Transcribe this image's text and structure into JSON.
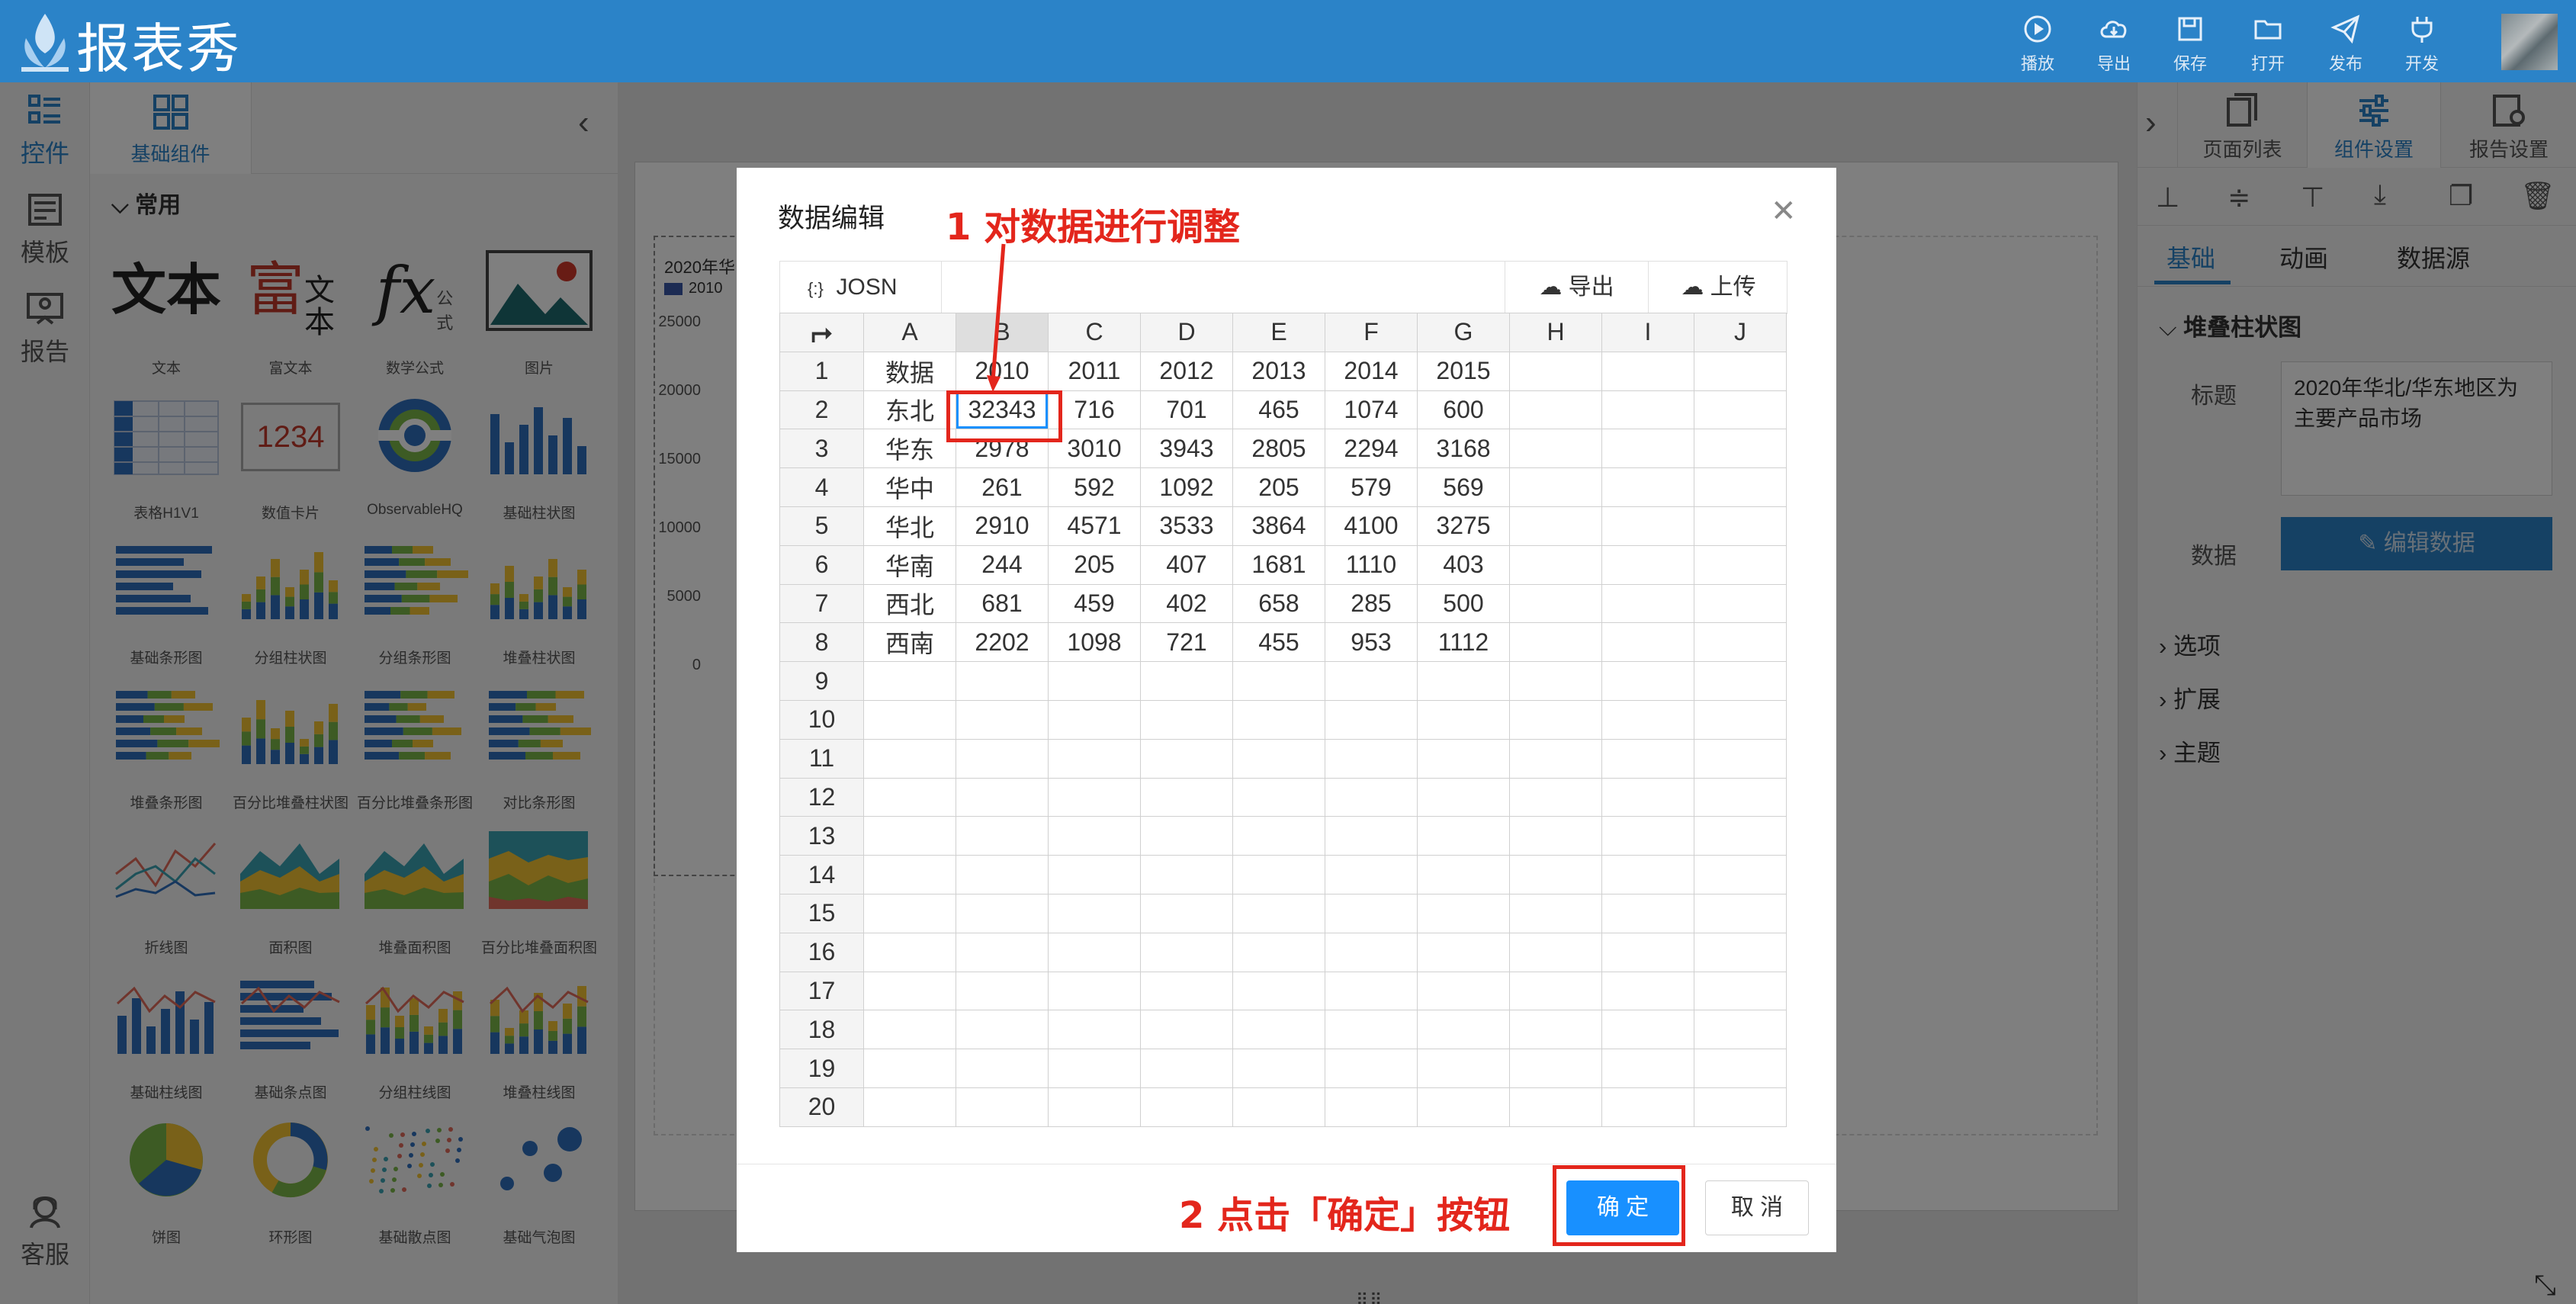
{
  "app": {
    "brand": "报表秀"
  },
  "header_actions": [
    {
      "label": "播放",
      "icon": "play-icon"
    },
    {
      "label": "导出",
      "icon": "download-cloud-icon"
    },
    {
      "label": "保存",
      "icon": "save-icon"
    },
    {
      "label": "打开",
      "icon": "folder-icon"
    },
    {
      "label": "发布",
      "icon": "send-icon"
    },
    {
      "label": "开发",
      "icon": "plug-icon"
    }
  ],
  "rail": [
    {
      "label": "控件",
      "icon": "widgets-icon",
      "active": true
    },
    {
      "label": "模板",
      "icon": "template-icon"
    },
    {
      "label": "报告",
      "icon": "report-icon"
    },
    {
      "label": "客服",
      "icon": "support-icon"
    }
  ],
  "component_panel": {
    "tab_label": "基础组件",
    "group_title": "常用",
    "items": [
      "文本",
      "富文本",
      "数学公式",
      "图片",
      "表格H1V1",
      "数值卡片",
      "ObservableHQ",
      "基础柱状图",
      "基础条形图",
      "分组柱状图",
      "分组条形图",
      "堆叠柱状图",
      "堆叠条形图",
      "百分比堆叠柱状图",
      "百分比堆叠条形图",
      "对比条形图",
      "折线图",
      "面积图",
      "堆叠面积图",
      "百分比堆叠面积图",
      "基础柱线图",
      "基础条点图",
      "分组柱线图",
      "堆叠柱线图",
      "饼图",
      "环形图",
      "基础散点图",
      "基础气泡图"
    ],
    "thumb_text": {
      "text": "文本",
      "rich_main": "富",
      "rich_sub": "文本",
      "formula": "fx",
      "formula_sub": "公式",
      "number": "1234"
    }
  },
  "canvas_chart": {
    "title_fragment": "2020年华",
    "legend": "2010",
    "yticks": [
      "25000",
      "20000",
      "15000",
      "10000",
      "5000",
      "0"
    ]
  },
  "right_panel": {
    "top_tabs": [
      "页面列表",
      "组件设置",
      "报告设置"
    ],
    "sub_tabs": [
      "基础",
      "动画",
      "数据源"
    ],
    "section_title": "堆叠柱状图",
    "title_label": "标题",
    "title_value": "2020年华北/华东地区为主要产品市场",
    "data_label": "数据",
    "edit_data_button": "编辑数据",
    "collapsed_sections": [
      "选项",
      "扩展",
      "主题"
    ]
  },
  "modal": {
    "title": "数据编辑",
    "json_button": "JOSN",
    "export_button": "导出",
    "upload_button": "上传",
    "ok_button": "确 定",
    "cancel_button": "取 消",
    "columns": [
      "A",
      "B",
      "C",
      "D",
      "E",
      "F",
      "G",
      "H",
      "I",
      "J"
    ],
    "rows": [
      [
        "数据",
        "2010",
        "2011",
        "2012",
        "2013",
        "2014",
        "2015",
        "",
        "",
        ""
      ],
      [
        "东北",
        "32343",
        "716",
        "701",
        "465",
        "1074",
        "600",
        "",
        "",
        ""
      ],
      [
        "华东",
        "2978",
        "3010",
        "3943",
        "2805",
        "2294",
        "3168",
        "",
        "",
        ""
      ],
      [
        "华中",
        "261",
        "592",
        "1092",
        "205",
        "579",
        "569",
        "",
        "",
        ""
      ],
      [
        "华北",
        "2910",
        "4571",
        "3533",
        "3864",
        "4100",
        "3275",
        "",
        "",
        ""
      ],
      [
        "华南",
        "244",
        "205",
        "407",
        "1681",
        "1110",
        "403",
        "",
        "",
        ""
      ],
      [
        "西北",
        "681",
        "459",
        "402",
        "658",
        "285",
        "500",
        "",
        "",
        ""
      ],
      [
        "西南",
        "2202",
        "1098",
        "721",
        "455",
        "953",
        "1112",
        "",
        "",
        ""
      ],
      [
        "",
        "",
        "",
        "",
        "",
        "",
        "",
        "",
        "",
        ""
      ],
      [
        "",
        "",
        "",
        "",
        "",
        "",
        "",
        "",
        "",
        ""
      ],
      [
        "",
        "",
        "",
        "",
        "",
        "",
        "",
        "",
        "",
        ""
      ],
      [
        "",
        "",
        "",
        "",
        "",
        "",
        "",
        "",
        "",
        ""
      ],
      [
        "",
        "",
        "",
        "",
        "",
        "",
        "",
        "",
        "",
        ""
      ],
      [
        "",
        "",
        "",
        "",
        "",
        "",
        "",
        "",
        "",
        ""
      ],
      [
        "",
        "",
        "",
        "",
        "",
        "",
        "",
        "",
        "",
        ""
      ],
      [
        "",
        "",
        "",
        "",
        "",
        "",
        "",
        "",
        "",
        ""
      ],
      [
        "",
        "",
        "",
        "",
        "",
        "",
        "",
        "",
        "",
        ""
      ],
      [
        "",
        "",
        "",
        "",
        "",
        "",
        "",
        "",
        "",
        ""
      ],
      [
        "",
        "",
        "",
        "",
        "",
        "",
        "",
        "",
        "",
        ""
      ],
      [
        "",
        "",
        "",
        "",
        "",
        "",
        "",
        "",
        "",
        ""
      ]
    ],
    "row_numbers": [
      "1",
      "2",
      "3",
      "4",
      "5",
      "6",
      "7",
      "8",
      "9",
      "10",
      "11",
      "12",
      "13",
      "14",
      "15",
      "16",
      "17",
      "18",
      "19",
      "20"
    ]
  },
  "annotations": {
    "step1": "1 对数据进行调整",
    "step2": "2 点击「确定」按钮"
  },
  "colors": {
    "brand": "#2b83c8",
    "primary": "#1890ff",
    "annotation": "#e3261c"
  }
}
